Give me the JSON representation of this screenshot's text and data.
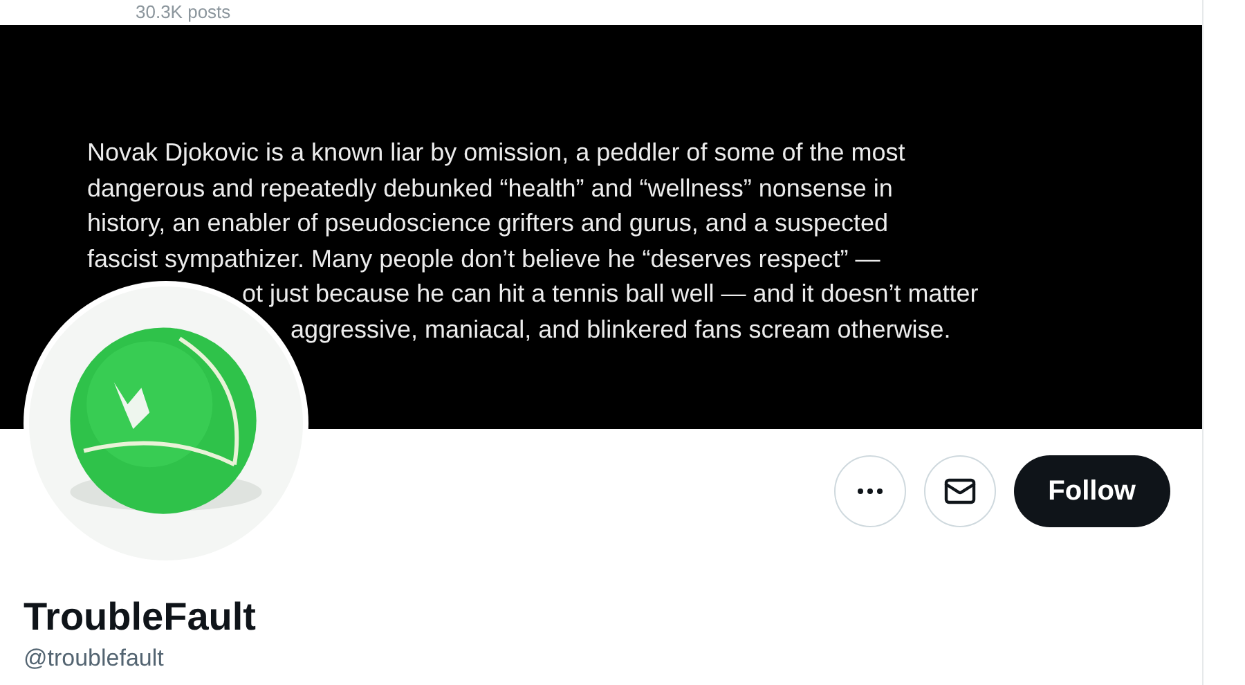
{
  "header": {
    "posts_count": "30.3K posts"
  },
  "banner": {
    "lines": [
      "Novak Djokovic is a known liar by omission, a peddler of some of the most",
      "dangerous and repeatedly debunked “health” and “wellness” nonsense in",
      "history, an enabler of pseudoscience grifters and gurus, and a suspected",
      "fascist sympathizer. Many people don’t believe he “deserves respect” —"
    ],
    "covered_lines": [
      "ot just because he can hit a tennis ball well — and it doesn’t matter",
      "aggressive, maniacal, and blinkered fans scream otherwise."
    ]
  },
  "actions": [
    {
      "kind": "more"
    },
    {
      "kind": "message"
    },
    {
      "kind": "follow",
      "label": "Follow"
    }
  ],
  "profile": {
    "name": "TroubleFault",
    "handle": "@troublefault"
  }
}
